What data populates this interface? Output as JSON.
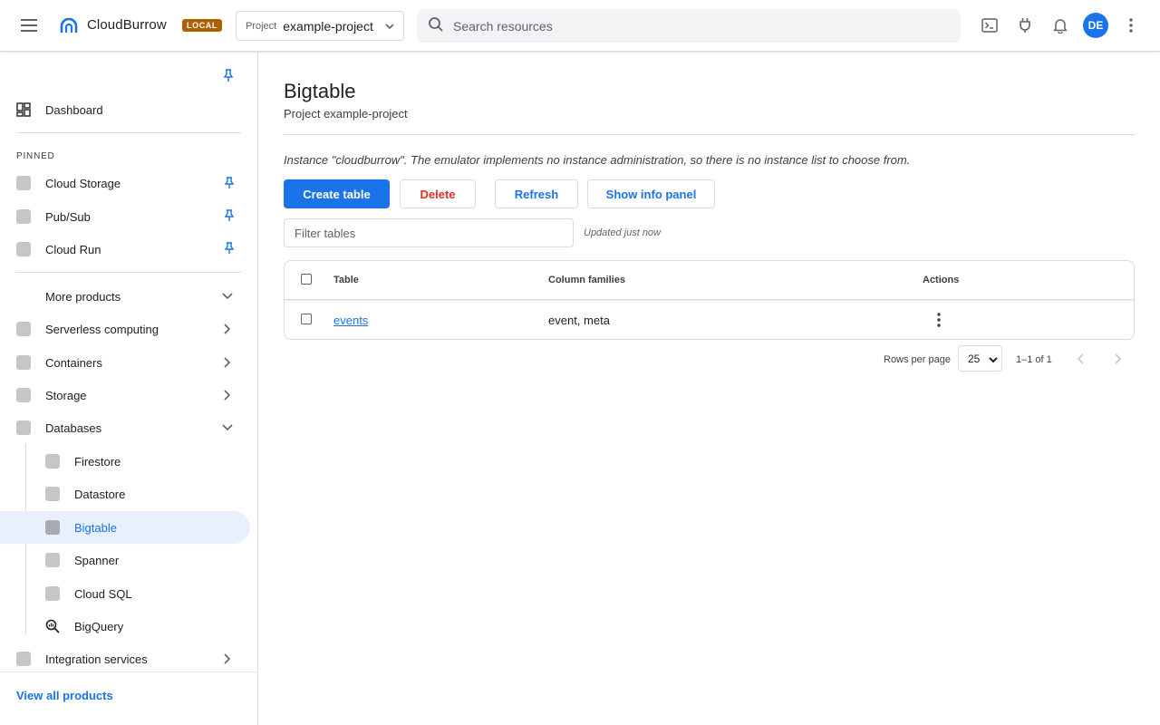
{
  "header": {
    "brand": "CloudBurrow",
    "env_badge": "LOCAL",
    "project_label": "Project",
    "project_value": "example-project",
    "search_placeholder": "Search resources",
    "avatar_initials": "DE",
    "accent_color": "#1a73e8",
    "badge_color": "#b06000"
  },
  "sidebar": {
    "dashboard": "Dashboard",
    "pinned_label": "PINNED",
    "pinned": [
      {
        "label": "Cloud Storage"
      },
      {
        "label": "Pub/Sub"
      },
      {
        "label": "Cloud Run"
      }
    ],
    "more_products": "More products",
    "categories": [
      {
        "label": "Serverless computing",
        "state": "collapsed"
      },
      {
        "label": "Containers",
        "state": "collapsed"
      },
      {
        "label": "Storage",
        "state": "collapsed"
      },
      {
        "label": "Databases",
        "state": "expanded"
      }
    ],
    "databases": [
      {
        "label": "Firestore"
      },
      {
        "label": "Datastore"
      },
      {
        "label": "Bigtable",
        "active": true
      },
      {
        "label": "Spanner"
      },
      {
        "label": "Cloud SQL"
      },
      {
        "label": "BigQuery",
        "icon": "search-analytics-icon"
      }
    ],
    "integration": "Integration services",
    "view_all": "View all products"
  },
  "main": {
    "title": "Bigtable",
    "subtitle": "Project example-project",
    "notice": "Instance \"cloudburrow\". The emulator implements no instance administration, so there is no instance list to choose from.",
    "buttons": {
      "create": "Create table",
      "delete": "Delete",
      "refresh": "Refresh",
      "info": "Show info panel"
    },
    "filter_placeholder": "Filter tables",
    "updated": "Updated just now",
    "table": {
      "headers": {
        "table": "Table",
        "families": "Column families",
        "actions": "Actions"
      },
      "rows": [
        {
          "name": "events",
          "families": "event, meta"
        }
      ]
    },
    "pagination": {
      "rows_per_page_label": "Rows per page",
      "rows_per_page": "25",
      "range": "1–1 of 1"
    }
  }
}
